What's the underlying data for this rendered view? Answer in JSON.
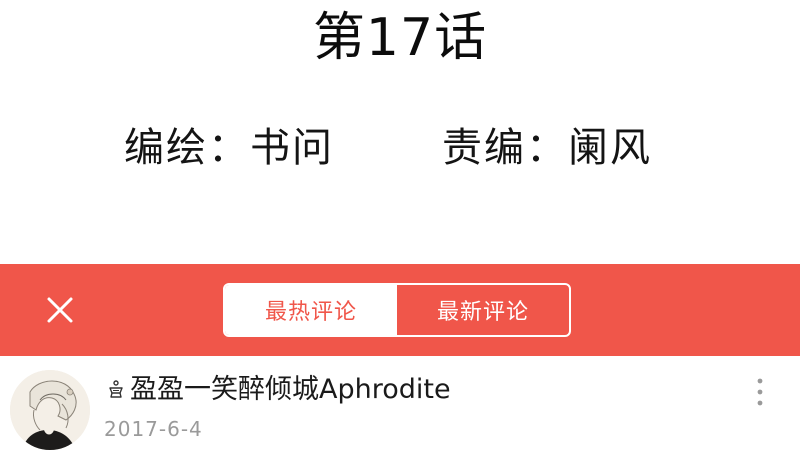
{
  "chapter": {
    "title": "第17话"
  },
  "credits": {
    "author": "编绘：书问",
    "editor": "责编：阑风"
  },
  "comment_bar": {
    "close_icon": "close-icon",
    "tabs": [
      {
        "label": "最热评论",
        "active": true
      },
      {
        "label": "最新评论",
        "active": false
      }
    ],
    "accent_color": "#f0564a"
  },
  "comment": {
    "avatar_icon": "avatar",
    "badge_icon": "crown-icon",
    "username": "盈盈一笑醉倾城Aphrodite",
    "date": "2017-6-4",
    "more_icon": "more-vertical-icon"
  }
}
